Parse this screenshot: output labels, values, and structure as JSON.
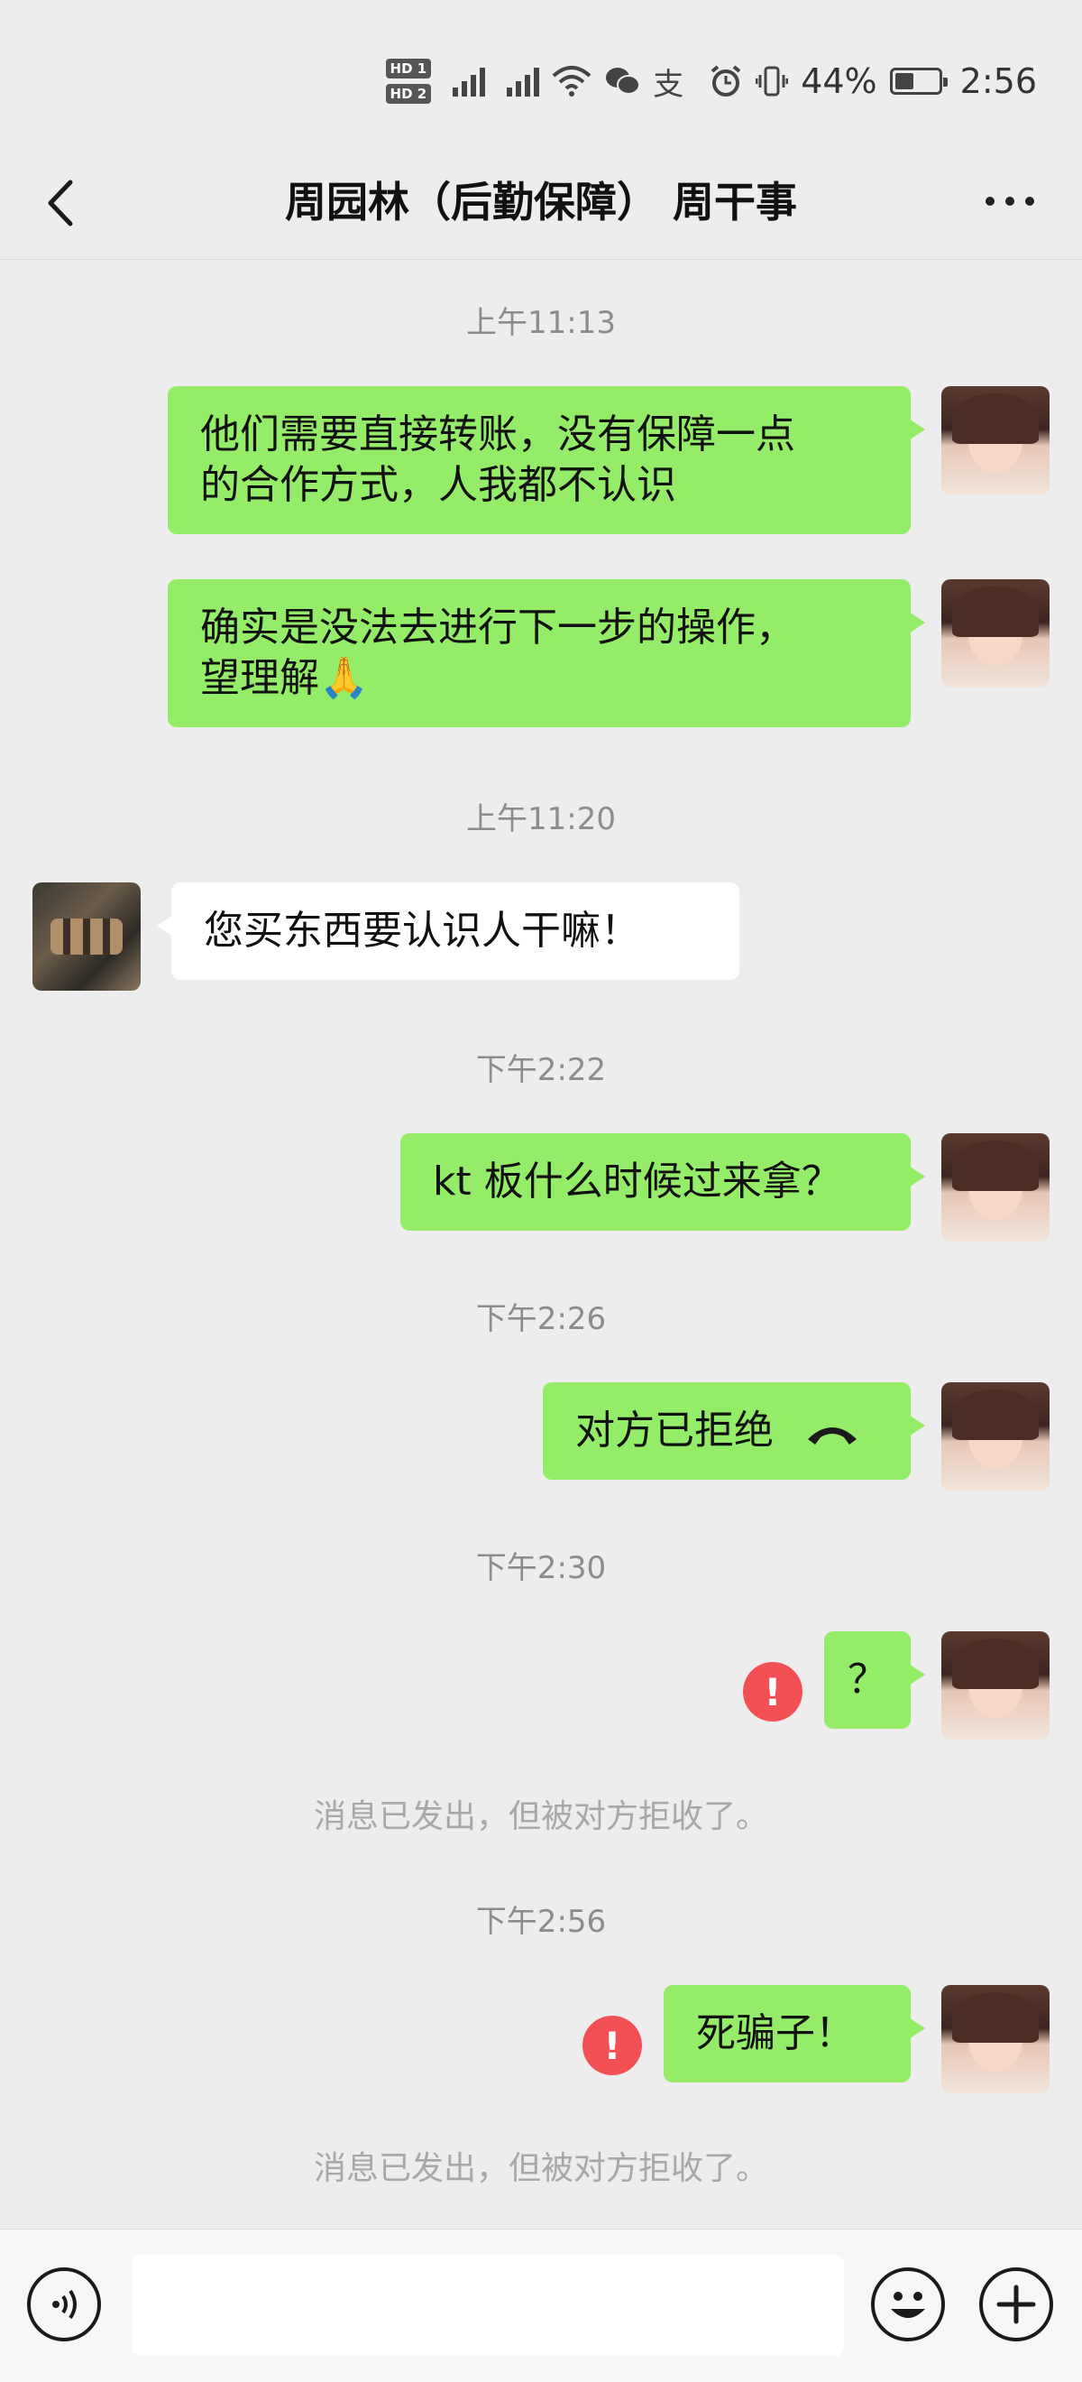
{
  "status_bar": {
    "hd1": "HD 1",
    "hd2": "HD 2",
    "battery_text": "44%",
    "battery_level": 0.44,
    "time": "2:56"
  },
  "header": {
    "title": "周园林（后勤保障） 周干事"
  },
  "messages": [
    {
      "type": "time",
      "text": "上午11:13"
    },
    {
      "type": "sent",
      "lines": [
        "他们需要直接转账，没有保障一点",
        "的合作方式，人我都不认识"
      ]
    },
    {
      "type": "sent",
      "lines": [
        "确实是没法去进行下一步的操作，",
        "望理解🙏"
      ]
    },
    {
      "type": "time",
      "text": "上午11:20"
    },
    {
      "type": "received",
      "text": "您买东西要认识人干嘛！"
    },
    {
      "type": "time",
      "text": "下午2:22"
    },
    {
      "type": "sent",
      "text": "kt 板什么时候过来拿？"
    },
    {
      "type": "time",
      "text": "下午2:26"
    },
    {
      "type": "sent_call",
      "text": "对方已拒绝",
      "icon": "hangup-icon"
    },
    {
      "type": "time",
      "text": "下午2:30"
    },
    {
      "type": "sent_failed",
      "text": "？",
      "error_mark": "!"
    },
    {
      "type": "notice",
      "text": "消息已发出，但被对方拒收了。"
    },
    {
      "type": "time",
      "text": "下午2:56"
    },
    {
      "type": "sent_failed",
      "text": "死骗子！",
      "error_mark": "!"
    },
    {
      "type": "notice",
      "text": "消息已发出，但被对方拒收了。"
    }
  ],
  "input_bar": {
    "placeholder": "",
    "icons": [
      "voice-icon",
      "emoji-icon",
      "plus-icon"
    ]
  },
  "colors": {
    "background": "#ededed",
    "sent_bubble": "#95ec69",
    "received_bubble": "#ffffff",
    "error": "#f25055"
  }
}
